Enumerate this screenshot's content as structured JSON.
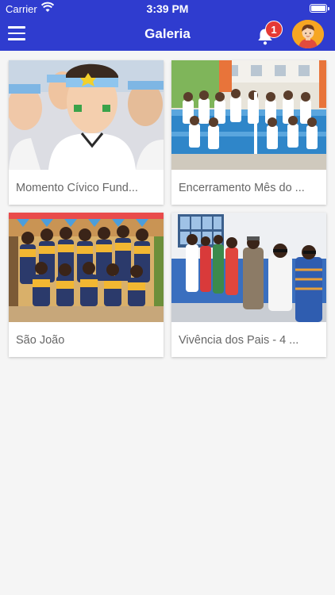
{
  "status_bar": {
    "carrier": "Carrier",
    "time": "3:39 PM"
  },
  "app_bar": {
    "title": "Galeria",
    "notification_count": "1",
    "colors": {
      "bar": "#2f3ccf",
      "badge": "#e53935",
      "avatar_bg": "#f6a623"
    }
  },
  "gallery": {
    "items": [
      {
        "label": "Momento Cívico Fund..."
      },
      {
        "label": "Encerramento Mês do ..."
      },
      {
        "label": "São João"
      },
      {
        "label": "Vivência dos Pais - 4 ..."
      }
    ]
  }
}
